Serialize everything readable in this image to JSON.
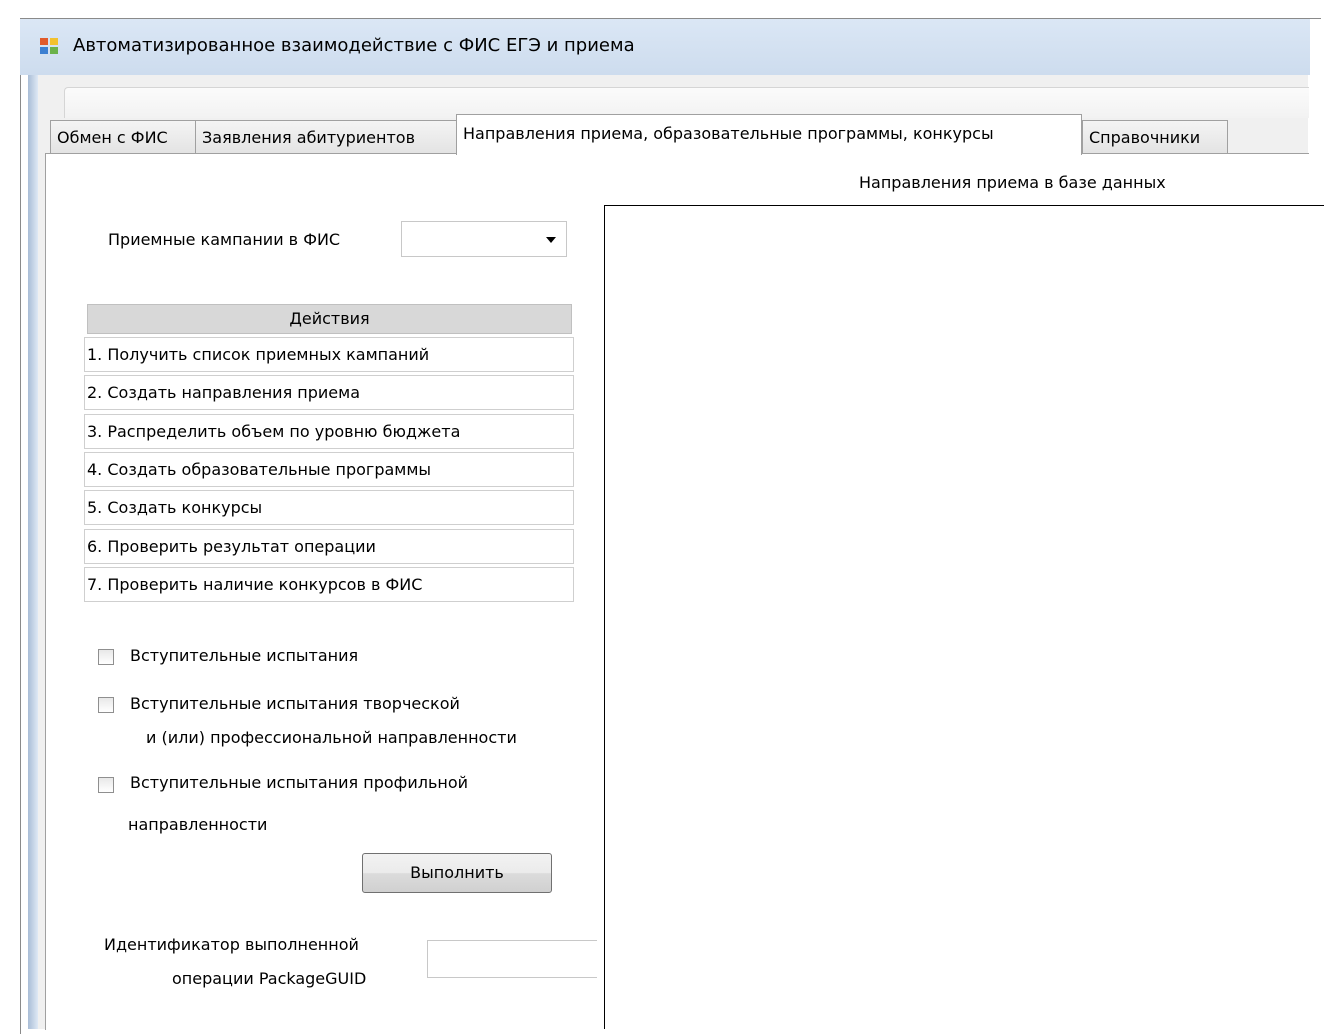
{
  "window": {
    "title": "Автоматизированное взаимодействие с ФИС ЕГЭ и приема"
  },
  "tabs": [
    {
      "label": "Обмен с ФИС",
      "active": false
    },
    {
      "label": "Заявления абитуриентов",
      "active": false
    },
    {
      "label": "Направления приема, образовательные программы, конкурсы",
      "active": true
    },
    {
      "label": "Справочники",
      "active": false
    }
  ],
  "campaign": {
    "label": "Приемные кампании в ФИС",
    "selected": ""
  },
  "actions": {
    "header": "Действия",
    "items": [
      "1. Получить список приемных кампаний",
      "2. Создать направления приема",
      "3. Распределить объем по уровню бюджета",
      "4. Создать образовательные программы",
      "5. Создать конкурсы",
      "6. Проверить результат операции",
      "7. Проверить наличие конкурсов в ФИС"
    ]
  },
  "checkboxes": [
    {
      "line1": "Вступительные испытания",
      "line2": "",
      "checked": false
    },
    {
      "line1": "Вступительные испытания творческой",
      "line2": "и (или) профессиональной направленности",
      "checked": false
    },
    {
      "line1": "Вступительные испытания профильной",
      "line2": "направленности",
      "checked": false
    }
  ],
  "execute_button": "Выполнить",
  "package": {
    "label_line1": "Идентификатор выполненной",
    "label_line2": "операции PackageGUID",
    "value": ""
  },
  "right_panel": {
    "title": "Направления приема в базе данных"
  },
  "colors": {
    "titlebar": "#cddcee",
    "client_bg": "#f0f0f0",
    "header_bg": "#d8d8d8"
  }
}
